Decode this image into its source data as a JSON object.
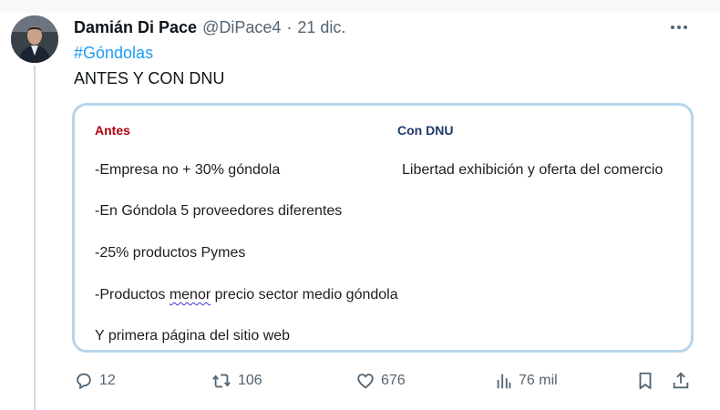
{
  "tweet": {
    "author_name": "Damián Di Pace",
    "handle": "@DiPace4",
    "separator": "·",
    "date": "21 dic.",
    "hashtag": "#Góndolas",
    "text": "ANTES Y CON DNU"
  },
  "image": {
    "left_heading": "Antes",
    "right_heading": "Con DNU",
    "left_lines": [
      "-Empresa no + 30% góndola",
      "-En Góndola 5 proveedores diferentes",
      "-25% productos Pymes"
    ],
    "line4_before": "-Productos ",
    "line4_underlined": "menor",
    "line4_after": " precio sector medio góndola",
    "line5": "Y primera página del sitio web",
    "right_line": "Libertad exhibición y oferta del comercio"
  },
  "actions": {
    "replies": "12",
    "retweets": "106",
    "likes": "676",
    "views": "76 mil"
  },
  "icons": {
    "more": "more-icon",
    "reply": "reply-icon",
    "retweet": "retweet-icon",
    "like": "heart-icon",
    "views": "views-icon",
    "bookmark": "bookmark-icon",
    "share": "share-icon"
  },
  "colors": {
    "hashtag": "#1d9bf0",
    "secondary_text": "#536471",
    "antes_heading": "#b00010",
    "dnu_heading": "#1f3a6b",
    "card_border": "#b7d6ea"
  }
}
